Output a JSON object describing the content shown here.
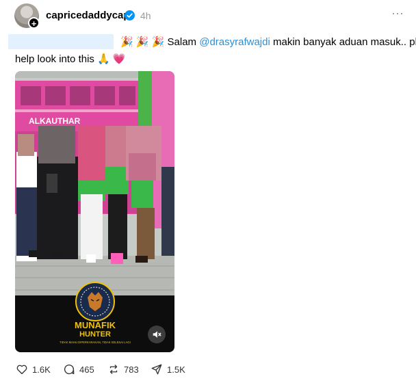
{
  "post": {
    "username": "capricedaddycap",
    "time": "4h",
    "more_icon": "⋯",
    "text_line1_prefix": "🎉 🎉 🎉 Salam ",
    "mention": "@drasyrafwajdi",
    "text_line1_suffix": " makin banyak aduan masuk.. pls",
    "text_line2": "help look into this 🙏 💗"
  },
  "media": {
    "storefront_sign": "ALKAUTHAR",
    "brand_title": "MUNAFIK",
    "brand_subtitle": "HUNTER",
    "brand_tagline": "TIDAK MAHU DIPERKARAKAN, TIDAK SELESAI LAGI"
  },
  "actions": {
    "likes": "1.6K",
    "replies": "465",
    "reposts": "783",
    "shares": "1.5K"
  },
  "colors": {
    "accent": "#2a8fd8",
    "verified": "#0095f6",
    "storefront": "#e04aa0",
    "brand_gold": "#f2c200"
  }
}
